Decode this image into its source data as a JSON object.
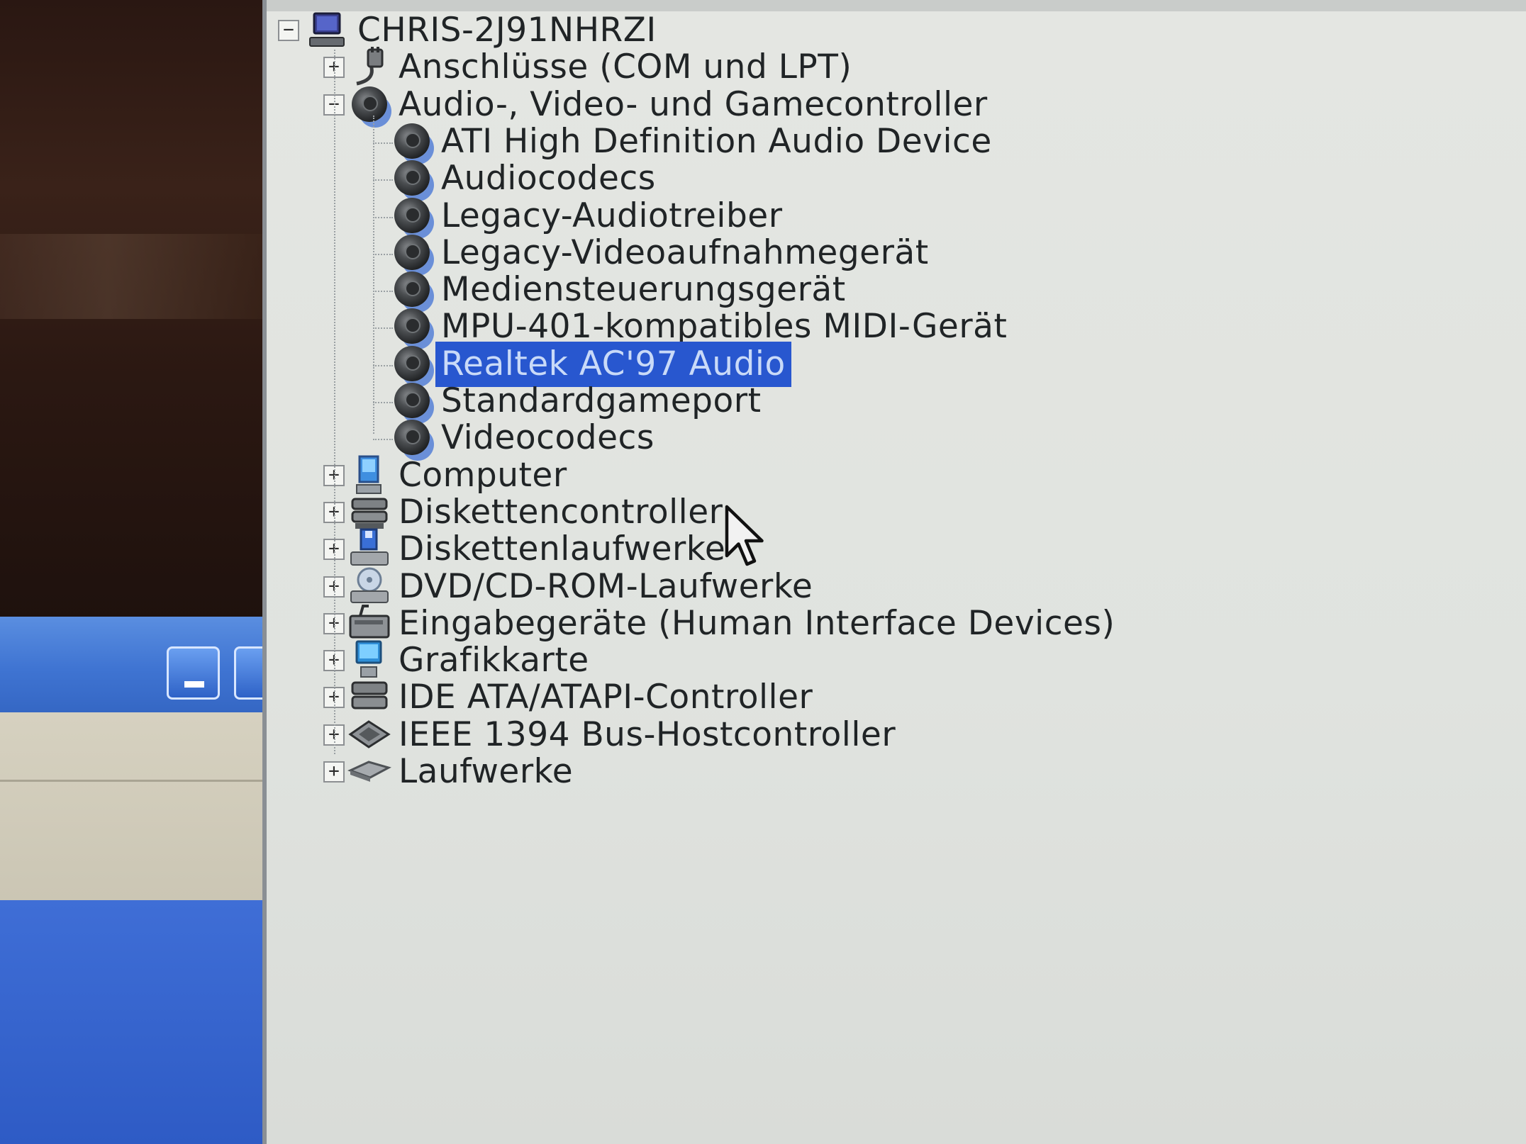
{
  "tree": {
    "root": {
      "label": "CHRIS-2J91NHRZI",
      "expander": "−",
      "icon": "computer-monitor-icon"
    },
    "nodes": [
      {
        "label": "Anschlüsse (COM und LPT)",
        "expander": "+",
        "icon": "port-connector-icon"
      },
      {
        "label": "Audio-, Video- und Gamecontroller",
        "expander": "−",
        "icon": "audio-speaker-icon",
        "children": [
          {
            "label": "ATI High Definition Audio Device",
            "icon": "audio-speaker-icon"
          },
          {
            "label": "Audiocodecs",
            "icon": "audio-speaker-icon"
          },
          {
            "label": "Legacy-Audiotreiber",
            "icon": "audio-speaker-icon"
          },
          {
            "label": "Legacy-Videoaufnahmegerät",
            "icon": "audio-speaker-icon"
          },
          {
            "label": "Mediensteuerungsgerät",
            "icon": "audio-speaker-icon"
          },
          {
            "label": "MPU-401-kompatibles MIDI-Gerät",
            "icon": "audio-speaker-icon"
          },
          {
            "label": "Realtek AC'97 Audio",
            "icon": "audio-speaker-icon",
            "selected": true
          },
          {
            "label": "Standardgameport",
            "icon": "audio-speaker-icon"
          },
          {
            "label": "Videocodecs",
            "icon": "audio-speaker-icon"
          }
        ]
      },
      {
        "label": "Computer",
        "expander": "+",
        "icon": "computer-icon"
      },
      {
        "label": "Diskettencontroller",
        "expander": "+",
        "icon": "floppy-controller-icon"
      },
      {
        "label": "Diskettenlaufwerke",
        "expander": "+",
        "icon": "floppy-drive-icon"
      },
      {
        "label": "DVD/CD-ROM-Laufwerke",
        "expander": "+",
        "icon": "cd-drive-icon"
      },
      {
        "label": "Eingabegeräte (Human Interface Devices)",
        "expander": "+",
        "icon": "input-device-icon"
      },
      {
        "label": "Grafikkarte",
        "expander": "+",
        "icon": "display-adapter-icon"
      },
      {
        "label": "IDE ATA/ATAPI-Controller",
        "expander": "+",
        "icon": "ide-controller-icon"
      },
      {
        "label": "IEEE 1394 Bus-Hostcontroller",
        "expander": "+",
        "icon": "ieee1394-icon"
      },
      {
        "label": "Laufwerke",
        "expander": "+",
        "icon": "disk-drive-icon"
      }
    ]
  },
  "colors": {
    "selection": "#2857cf",
    "selection_text": "#c9daf8",
    "pane_bg": "#e2e5e1"
  }
}
